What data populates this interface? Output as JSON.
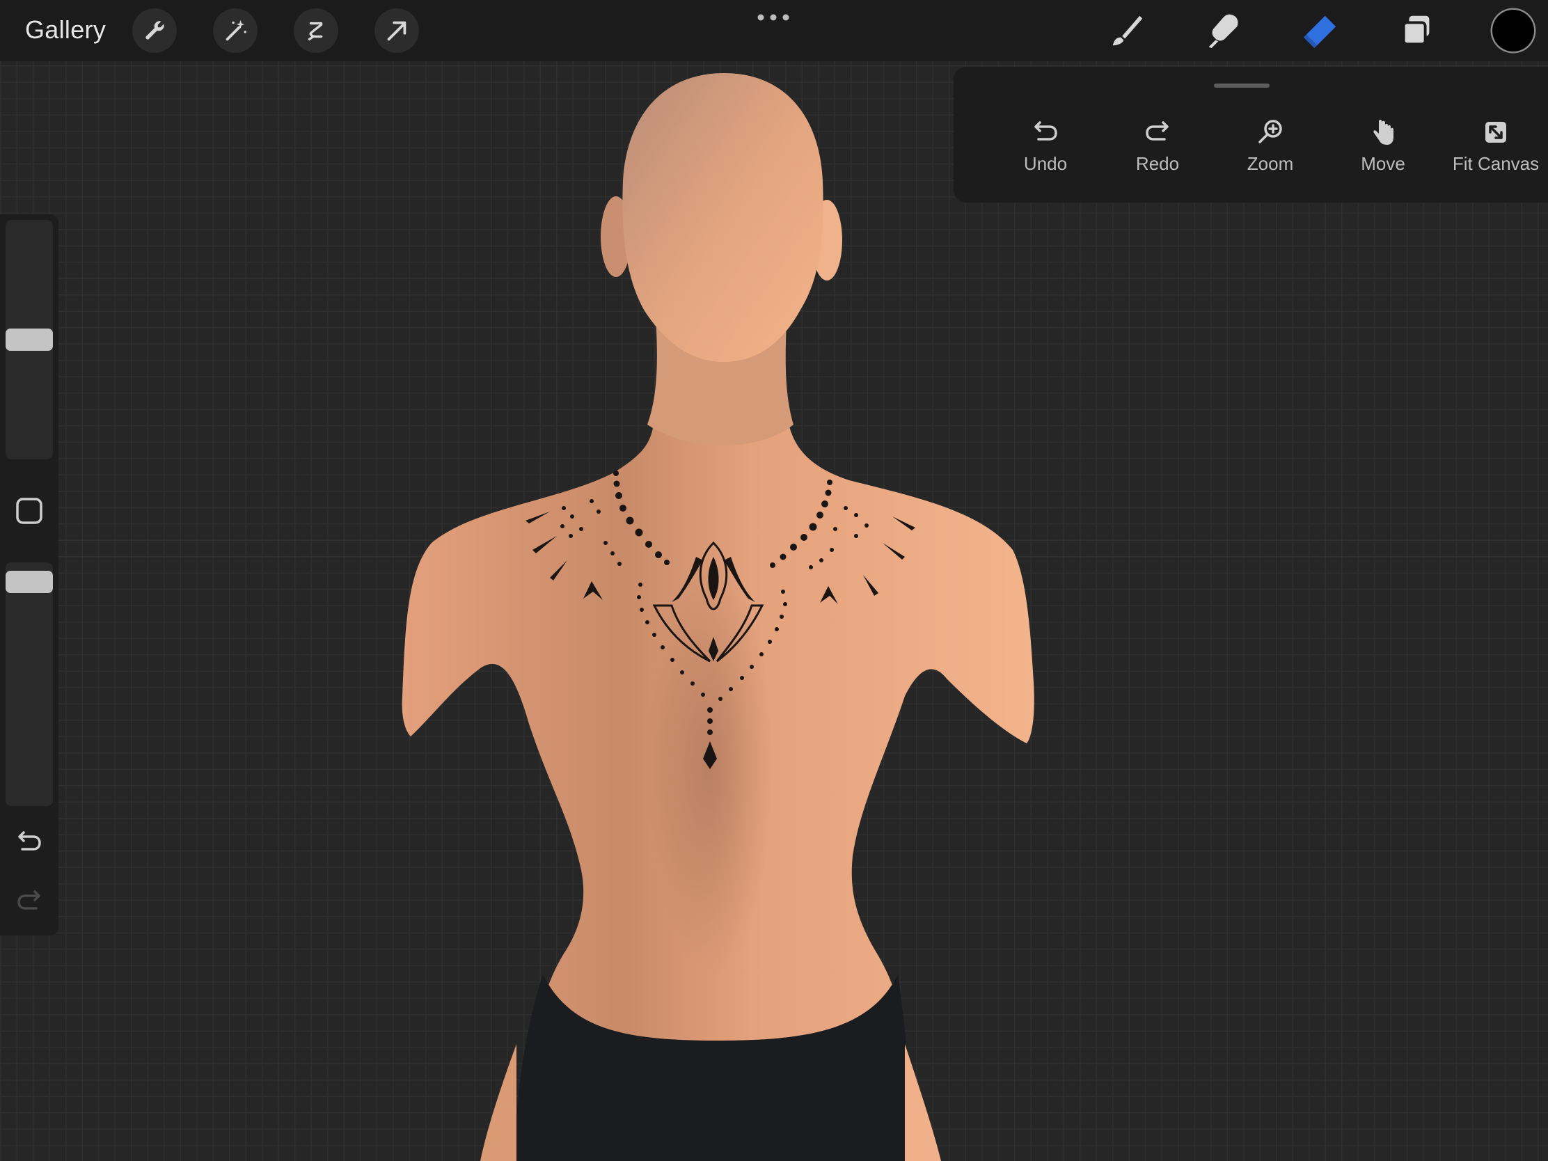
{
  "topbar": {
    "gallery_label": "Gallery",
    "left_tools": [
      {
        "name": "wrench-icon",
        "label": "Actions"
      },
      {
        "name": "magic-wand-icon",
        "label": "Adjustments"
      },
      {
        "name": "selection-icon",
        "label": "Selection"
      },
      {
        "name": "transform-arrow-icon",
        "label": "Transform"
      }
    ],
    "more_icon": "ellipsis-icon",
    "right_tools": [
      {
        "name": "brush-icon",
        "label": "Paint"
      },
      {
        "name": "smudge-icon",
        "label": "Smudge"
      },
      {
        "name": "eraser-icon",
        "label": "Erase",
        "active": true
      },
      {
        "name": "layers-icon",
        "label": "Layers"
      }
    ],
    "current_color": "#000000"
  },
  "quick_menu": {
    "items": [
      {
        "icon": "undo-icon",
        "label": "Undo"
      },
      {
        "icon": "redo-icon",
        "label": "Redo"
      },
      {
        "icon": "zoom-icon",
        "label": "Zoom"
      },
      {
        "icon": "hand-icon",
        "label": "Move"
      },
      {
        "icon": "fit-canvas-icon",
        "label": "Fit Canvas"
      }
    ]
  },
  "sidebar": {
    "brush_size_level": 0.5,
    "opacity_level": 1.0,
    "modify_icon": "square-icon",
    "undo_icon": "undo-icon",
    "redo_icon": "redo-icon"
  },
  "colors": {
    "accent_blue": "#2f6fe0",
    "skin": "#e8a07a",
    "toolbar_bg": "#1b1b1b",
    "canvas_bg": "#262626"
  }
}
